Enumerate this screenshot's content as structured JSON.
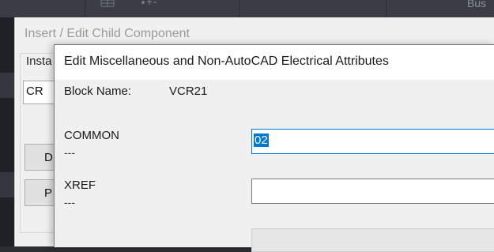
{
  "ribbon": {
    "bus_label": "Bus",
    "icons": [
      "grid-icon",
      "snap-icon"
    ]
  },
  "back_dialog": {
    "title": "Insert / Edit Child Component",
    "group_label": "Insta",
    "input_value": "CR",
    "buttons": [
      "D",
      "P"
    ]
  },
  "front_dialog": {
    "title": "Edit Miscellaneous and Non-AutoCAD Electrical Attributes",
    "block_name_label": "Block Name:",
    "block_name_value": "VCR21",
    "attributes": [
      {
        "name": "COMMON",
        "sub": "---",
        "value": "02"
      },
      {
        "name": "XREF",
        "sub": "---",
        "value": ""
      }
    ]
  },
  "colors": {
    "selection": "#0078d7",
    "dialog_bg": "#f0f0f0",
    "app_bg": "#2b2d33"
  }
}
